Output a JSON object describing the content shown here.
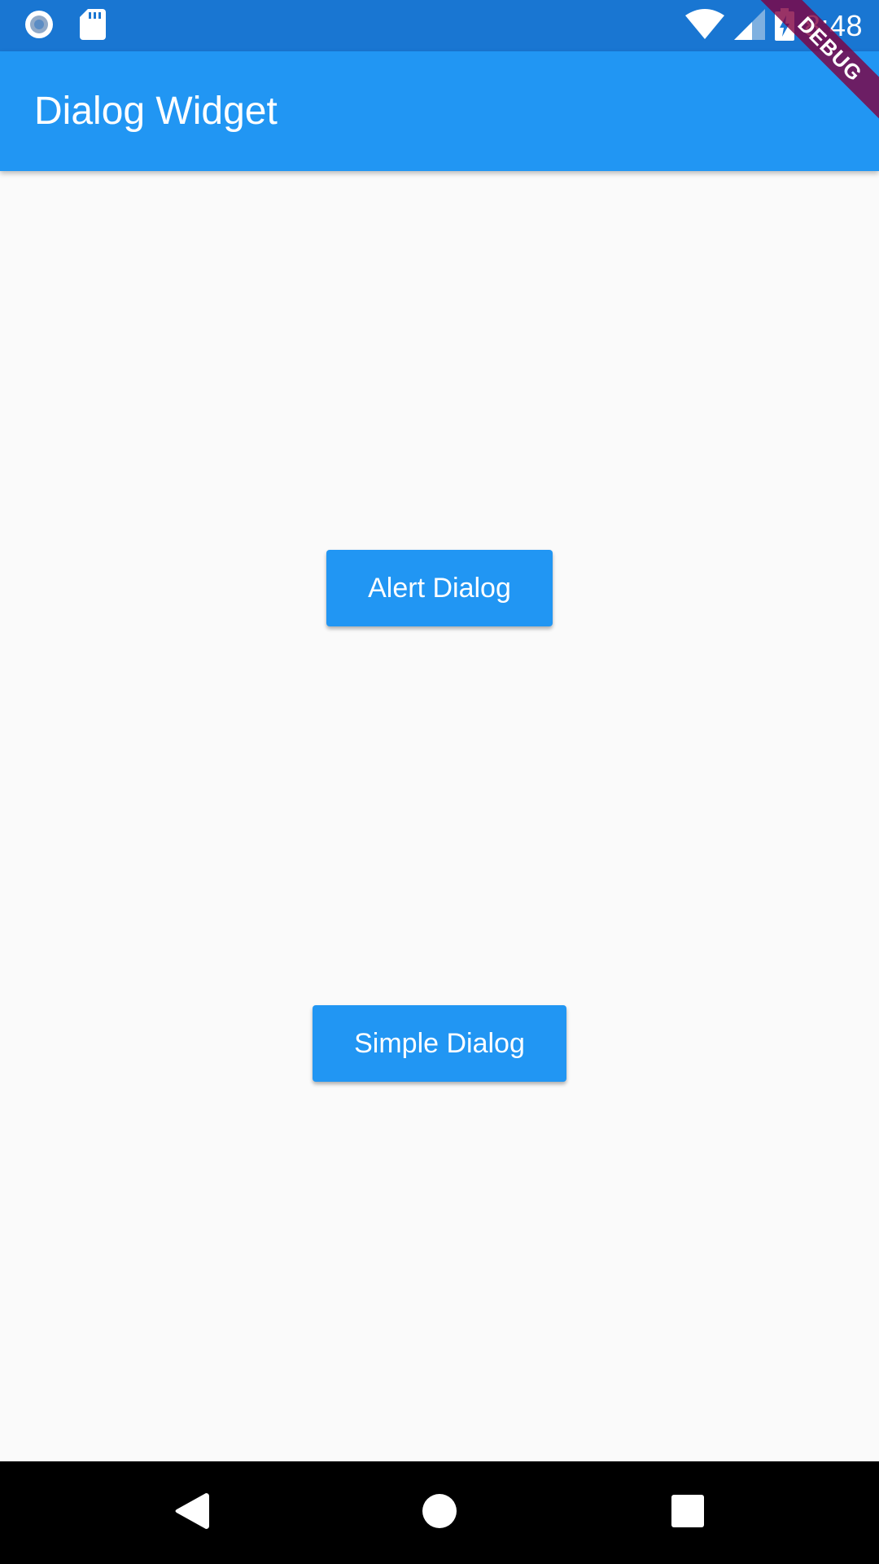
{
  "status_bar": {
    "time": "8:48",
    "left_icons": [
      "record-icon",
      "sd-card-icon"
    ],
    "right_icons": [
      "wifi-icon",
      "signal-icon",
      "battery-charging-icon"
    ],
    "color": "#1976d2"
  },
  "app_bar": {
    "title": "Dialog Widget",
    "color": "#2196f3"
  },
  "debug_banner": {
    "label": "DEBUG"
  },
  "main": {
    "buttons": [
      {
        "label": "Alert Dialog"
      },
      {
        "label": "Simple Dialog"
      }
    ],
    "background": "#fafafa"
  },
  "nav_bar": {
    "icons": [
      "back-icon",
      "home-icon",
      "recent-apps-icon"
    ]
  }
}
